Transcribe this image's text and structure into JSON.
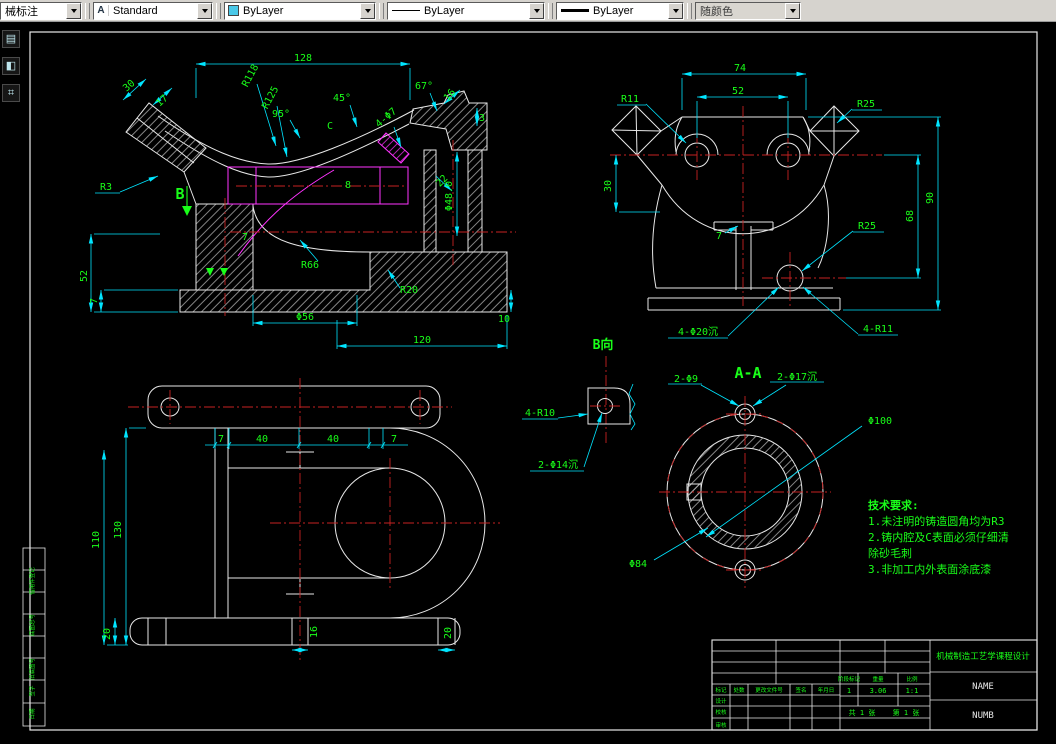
{
  "toolbar": {
    "dim_style_label": "械标注",
    "text_style_label": "Standard",
    "color_label": "ByLayer",
    "color_swatch": "#49c8e8",
    "linetype_label": "ByLayer",
    "lineweight_label": "ByLayer",
    "plot_style_label": "随颜色"
  },
  "colors": {
    "background": "#000000",
    "geometry": "#e8e8e8",
    "dimension_line": "#00e5ff",
    "dimension_text": "#19ff19",
    "centerline": "#c62222",
    "auxiliary": "#ff33ff"
  },
  "drawing": {
    "front": {
      "d128": "128",
      "d30": "30",
      "d17": "17",
      "r118": "R118",
      "r125": "R125",
      "a45": "45°",
      "a95": "95°",
      "c": "C",
      "h47": "4-Φ7",
      "a67": "67°",
      "d16": "16",
      "d3": "3",
      "d22": "22",
      "d8": "8",
      "r3": "R3",
      "b": "B",
      "d52": "52",
      "d7a": "7",
      "d7b": "7",
      "r66": "R66",
      "r20": "R20",
      "d56": "Φ56",
      "d120": "120",
      "d10": "10",
      "d48": "Φ48.0"
    },
    "side": {
      "d74": "74",
      "d52": "52",
      "r11": "R11",
      "r25a": "R25",
      "d30": "30",
      "d68": "68",
      "d90": "90",
      "d7": "7",
      "r25b": "R25",
      "holes": "4-Φ20沉",
      "r11x4": "4-R11"
    },
    "plan": {
      "d110": "110",
      "d130": "130",
      "d7a": "7",
      "d40a": "40",
      "d40b": "40",
      "d7b": "7",
      "d20a": "20",
      "d16": "16",
      "d20b": "20"
    },
    "bview": {
      "title": "B向",
      "r10": "4-R10",
      "d14": "2-Φ14沉"
    },
    "section": {
      "title": "A-A",
      "d9": "2-Φ9",
      "d17": "2-Φ17沉",
      "d100": "Φ100",
      "d84": "Φ84"
    },
    "notes": [
      "技术要求:",
      "1.未注明的铸造圆角均为R3",
      "2.铸内腔及C表面必须仔细清",
      "除砂毛刺",
      "3.非加工内外表面涂底漆"
    ]
  },
  "title_block": {
    "title": "机械制造工艺学课程设计",
    "name": "NAME",
    "numb": "NUMB",
    "qty": "1",
    "weight": "3.06",
    "scale": "1:1",
    "sheets": "共 1 张",
    "sheet_no": "第 1 张",
    "h_stage": "阶段标记",
    "h_weight": "重量",
    "h_scale": "比例",
    "h_mark": "标记",
    "h_count": "处数",
    "h_file": "更改文件号",
    "h_sign": "签名",
    "h_date": "年月日",
    "r_design": "设计",
    "r_check": "校核",
    "r_audit": "审核"
  },
  "side_table": {
    "rows": [
      "",
      "借用件登记",
      "",
      "底图总号",
      "",
      "旧底图号",
      "签字",
      "日期"
    ]
  }
}
